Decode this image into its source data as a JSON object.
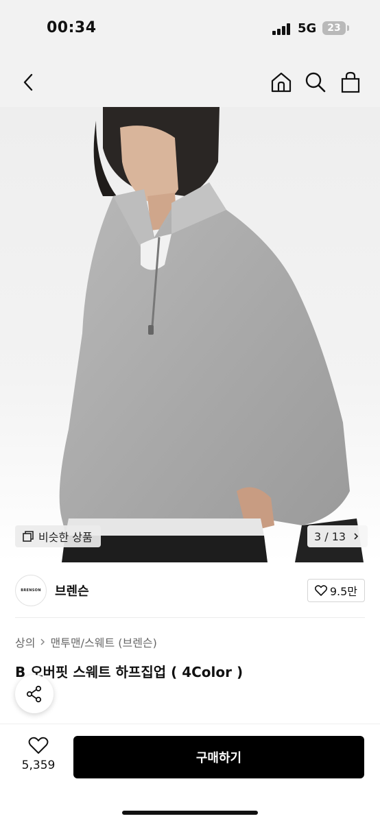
{
  "status_bar": {
    "time": "00:34",
    "network": "5G",
    "battery": "23"
  },
  "hero": {
    "similar_label": "비슷한 상품",
    "page_indicator": "3 / 13"
  },
  "brand": {
    "logo_text": "BRENSON",
    "name": "브렌슨",
    "likes": "9.5만"
  },
  "breadcrumb": {
    "category": "상의",
    "subcategory": "맨투맨/스웨트 (브렌슨)"
  },
  "product": {
    "title": "B 오버핏 스웨트 하프집업 ( 4Color )"
  },
  "bottom_bar": {
    "wish_count": "5,359",
    "buy_label": "구매하기"
  },
  "icons": [
    "back-icon",
    "home-icon",
    "search-icon",
    "bag-icon",
    "copy-icon",
    "chevron-right-icon",
    "heart-icon",
    "share-icon"
  ]
}
